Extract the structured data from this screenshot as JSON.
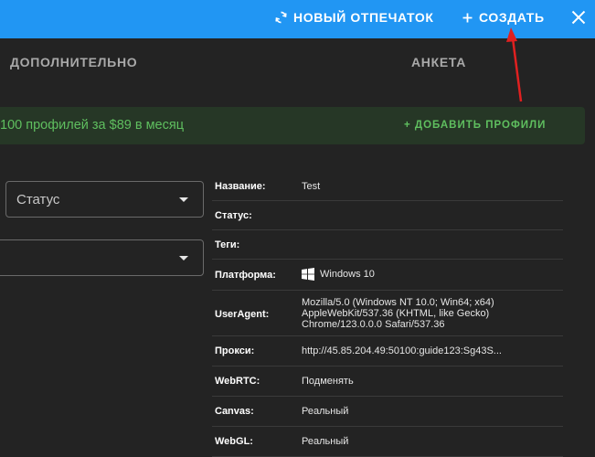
{
  "topbar": {
    "new_fingerprint_label": "НОВЫЙ ОТПЕЧАТОК",
    "create_label": "СОЗДАТЬ",
    "new_fingerprint_icon": "refresh-icon",
    "create_icon": "plus-icon",
    "close_icon": "close-icon",
    "accent_color": "#2196f3"
  },
  "tabs": {
    "extra": "ДОПОЛНИТЕЛЬНО",
    "profile": "АНКЕТА"
  },
  "promo": {
    "text": "100 профилей за $89 в месяц",
    "add_button": "+ ДОБАВИТЬ ПРОФИЛИ",
    "color": "#5fbf5f"
  },
  "filters": {
    "status_label": "Статус",
    "second_label": ""
  },
  "details": {
    "name": {
      "key": "Название:",
      "value": "Test"
    },
    "status": {
      "key": "Статус:",
      "value": ""
    },
    "tags": {
      "key": "Теги:",
      "value": ""
    },
    "platform": {
      "key": "Платформа:",
      "value": "Windows 10",
      "icon": "windows-icon"
    },
    "useragent": {
      "key": "UserAgent:",
      "lines": [
        "Mozilla/5.0 (Windows NT 10.0; Win64; x64)",
        "AppleWebKit/537.36 (KHTML, like Gecko)",
        "Chrome/123.0.0.0 Safari/537.36"
      ]
    },
    "proxy": {
      "key": "Прокси:",
      "value": "http://45.85.204.49:50100:guide123:Sg43S..."
    },
    "webrtc": {
      "key": "WebRTC:",
      "value": "Подменять"
    },
    "canvas": {
      "key": "Canvas:",
      "value": "Реальный"
    },
    "webgl": {
      "key": "WebGL:",
      "value": "Реальный"
    }
  },
  "annotation": {
    "arrow_color": "#e02020"
  }
}
